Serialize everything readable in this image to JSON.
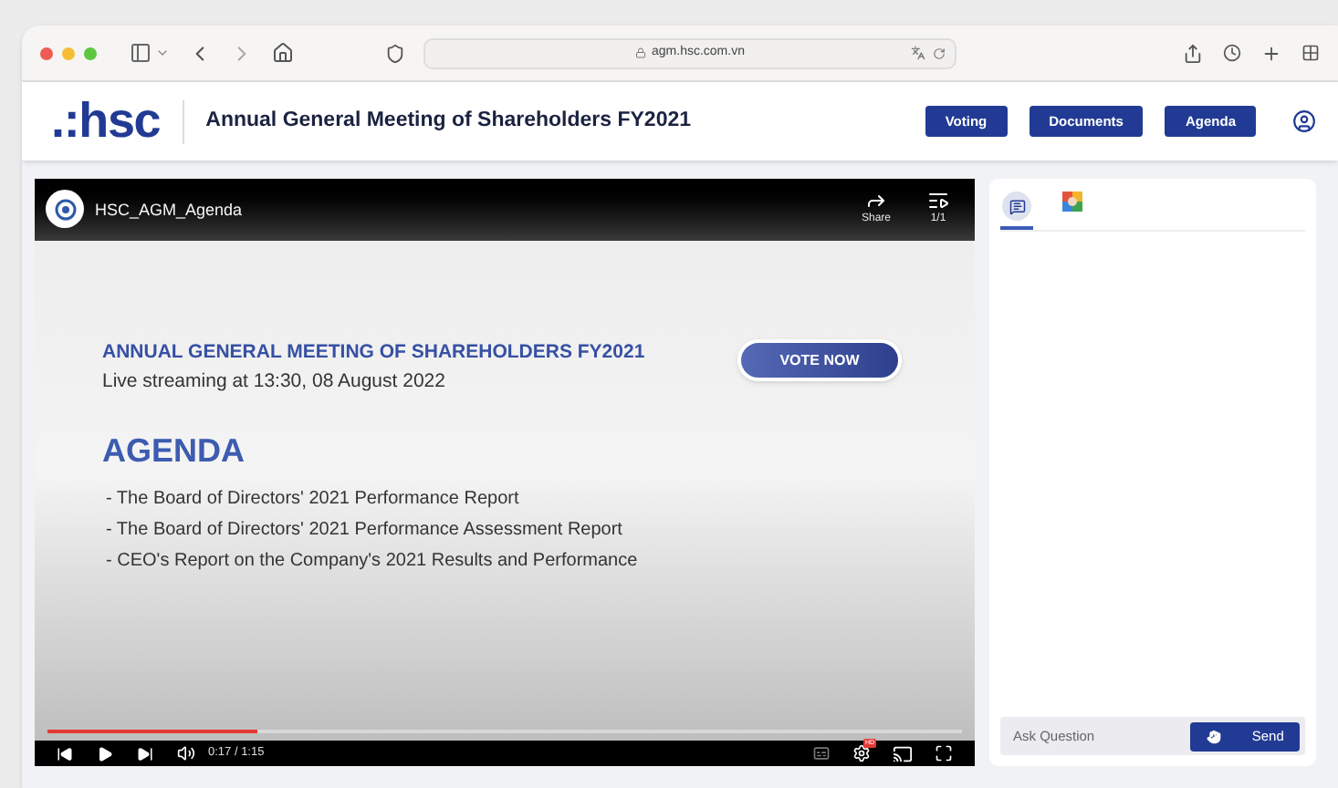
{
  "browser": {
    "url": "agm.hsc.com.vn"
  },
  "header": {
    "logo": ".:hsc",
    "title": "Annual General Meeting of Shareholders FY2021",
    "nav": [
      "Voting",
      "Documents",
      "Agenda"
    ]
  },
  "video": {
    "title": "HSC_AGM_Agenda",
    "share_label": "Share",
    "playlist_label": "1/1",
    "slide": {
      "heading": "ANNUAL GENERAL MEETING OF SHAREHOLDERS FY2021",
      "subheading": "Live streaming at 13:30, 08 August 2022",
      "vote_button": "VOTE NOW",
      "agenda_title": "AGENDA",
      "agenda_items": [
        "- The Board of Directors' 2021 Performance Report",
        "- The Board of Directors' 2021 Performance Assessment Report",
        "- CEO's Report on the Company's 2021 Results and Performance"
      ]
    },
    "progress": {
      "level": 0.23
    },
    "time": "0:17 / 1:15",
    "settings_badge": "HD"
  },
  "panel": {
    "tabs": [
      {
        "kind": "chat",
        "selected": true
      },
      {
        "kind": "app",
        "selected": false
      }
    ],
    "question": {
      "placeholder": "Ask Question"
    },
    "send": "Send"
  }
}
